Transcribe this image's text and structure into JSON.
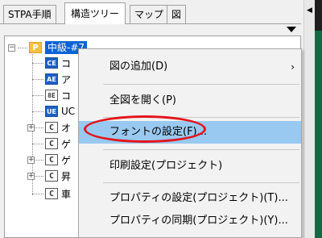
{
  "tabs": [
    {
      "label": "STPA手順"
    },
    {
      "label": "構造ツリー"
    },
    {
      "label": "マップ"
    },
    {
      "label": "図"
    }
  ],
  "tab_arrows": {
    "left": "◀",
    "right": "▶"
  },
  "tree": {
    "root_icon": "P",
    "root_label": "中級-#7",
    "items": [
      {
        "icon": "CE",
        "label": "コ"
      },
      {
        "icon": "AE",
        "label": "ア"
      },
      {
        "icon": "8E",
        "label": "コ"
      },
      {
        "icon": "UE",
        "label": "UC"
      },
      {
        "icon": "C",
        "label": "オ"
      },
      {
        "icon": "C",
        "label": "ゲ"
      },
      {
        "icon": "C",
        "label": "ゲ"
      },
      {
        "icon": "C",
        "label": "昇"
      },
      {
        "icon": "C",
        "label": "車"
      }
    ]
  },
  "menu": {
    "items": [
      {
        "label": "図の追加(D)",
        "has_submenu": true
      },
      {
        "label": "全図を開く(P)"
      },
      {
        "label": "フォントの設定(F)...",
        "highlighted": true
      },
      {
        "label": "印刷設定(プロジェクト)"
      },
      {
        "label": "プロパティの設定(プロジェクト)(T)..."
      },
      {
        "label": "プロパティの同期(プロジェクト)(Y)..."
      }
    ],
    "submenu_arrow": "›"
  },
  "colors": {
    "highlight": "#99c9f0",
    "annotation_circle": "#e3141a",
    "root_selection": "#0b63d6",
    "side_panel": "#0f6b45"
  }
}
